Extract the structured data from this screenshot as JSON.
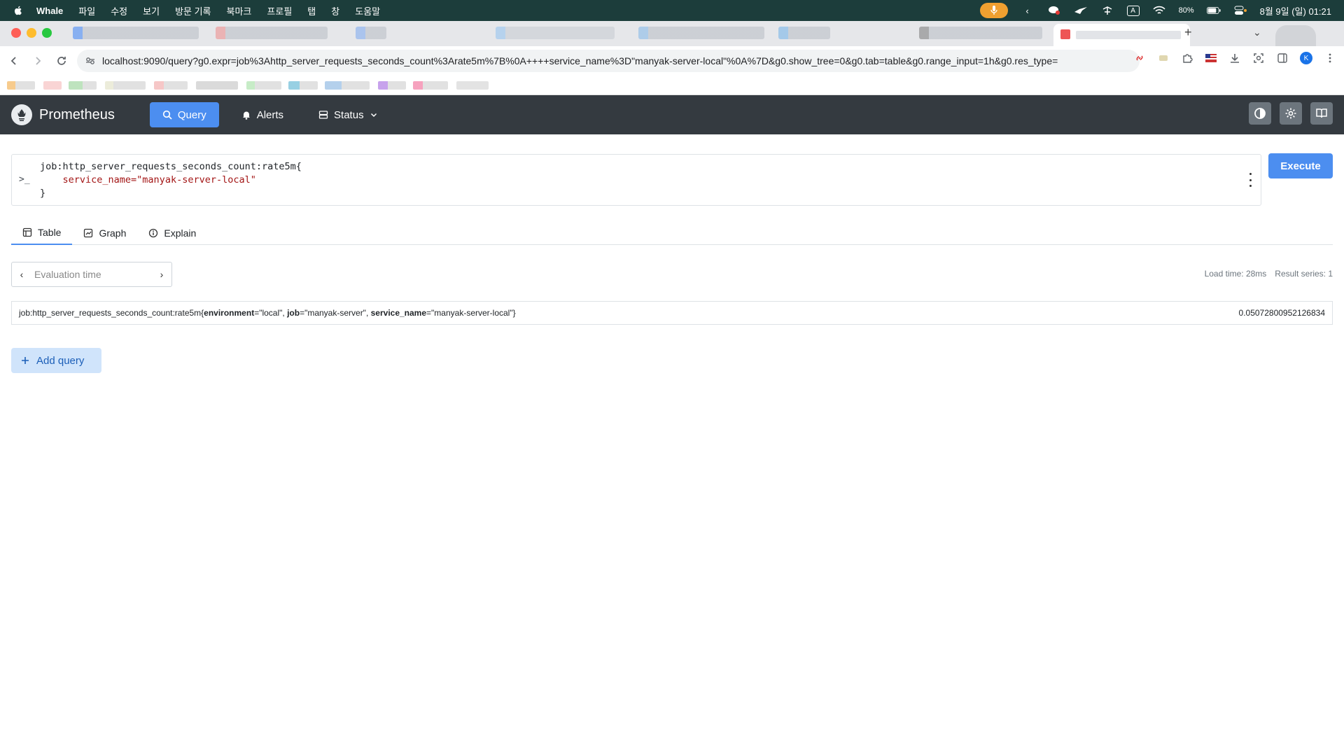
{
  "menubar": {
    "app_name": "Whale",
    "items": [
      "파일",
      "수정",
      "보기",
      "방문 기록",
      "북마크",
      "프로필",
      "탭",
      "창",
      "도움말"
    ],
    "battery": "80%",
    "input_source": "A",
    "datetime": "8월 9일 (일) 01:21"
  },
  "browser": {
    "url": "localhost:9090/query?g0.expr=job%3Ahttp_server_requests_seconds_count%3Arate5m%7B%0A++++service_name%3D\"manyak-server-local\"%0A%7D&g0.show_tree=0&g0.tab=table&g0.range_input=1h&g0.res_type=",
    "profile_initial": "K"
  },
  "nav": {
    "brand": "Prometheus",
    "query": "Query",
    "alerts": "Alerts",
    "status": "Status"
  },
  "query": {
    "line1": "job:http_server_requests_seconds_count:rate5m{",
    "line2_indent": "    ",
    "line2_str": "service_name=\"manyak-server-local\"",
    "line3": "}",
    "execute": "Execute"
  },
  "tabs": {
    "table": "Table",
    "graph": "Graph",
    "explain": "Explain"
  },
  "eval": {
    "placeholder": "Evaluation time"
  },
  "stats": {
    "load_time": "Load time: 28ms",
    "result_series": "Result series: 1"
  },
  "result": {
    "metric": "job:http_server_requests_seconds_count:rate5m{",
    "labels": [
      {
        "key": "environment",
        "value": "=\"local\", "
      },
      {
        "key": "job",
        "value": "=\"manyak-server\", "
      },
      {
        "key": "service_name",
        "value": "=\"manyak-server-local\"}"
      }
    ],
    "value": "0.05072800952126834"
  },
  "add_query": "Add query",
  "colors": {
    "accent": "#4c8ef0",
    "navbar": "#343a40",
    "menubar": "#1c3d3b"
  }
}
